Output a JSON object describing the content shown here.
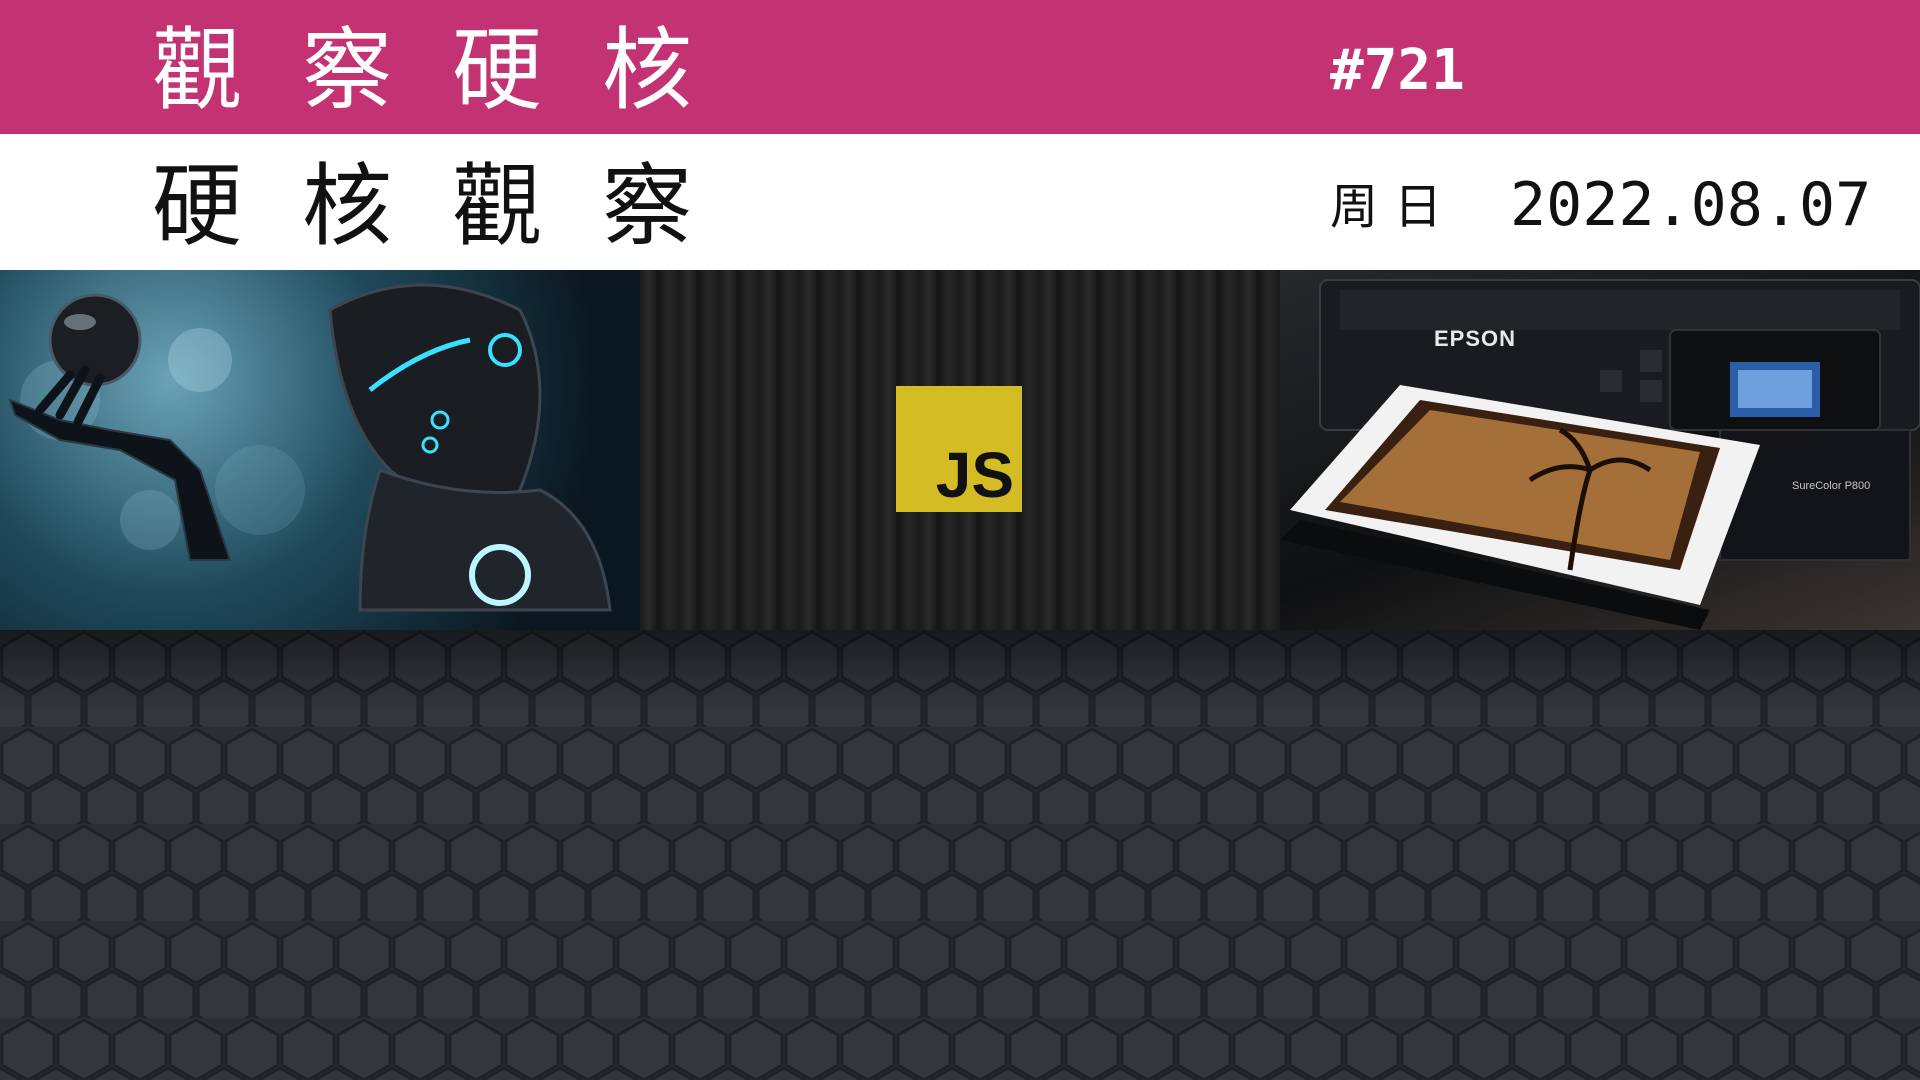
{
  "header": {
    "title": "觀察硬核",
    "issue": "#721",
    "subtitle": "硬核觀察",
    "weekday": "周日",
    "date": "2022.08.07"
  },
  "panels": {
    "robot": {
      "icon": "robot-illustration"
    },
    "js": {
      "logo_text": "JS",
      "logo_color": "#d4bc25"
    },
    "printer": {
      "brand": "EPSON",
      "model": "SureColor P800"
    }
  },
  "colors": {
    "accent": "#c33374",
    "background": "#2b2f35"
  }
}
